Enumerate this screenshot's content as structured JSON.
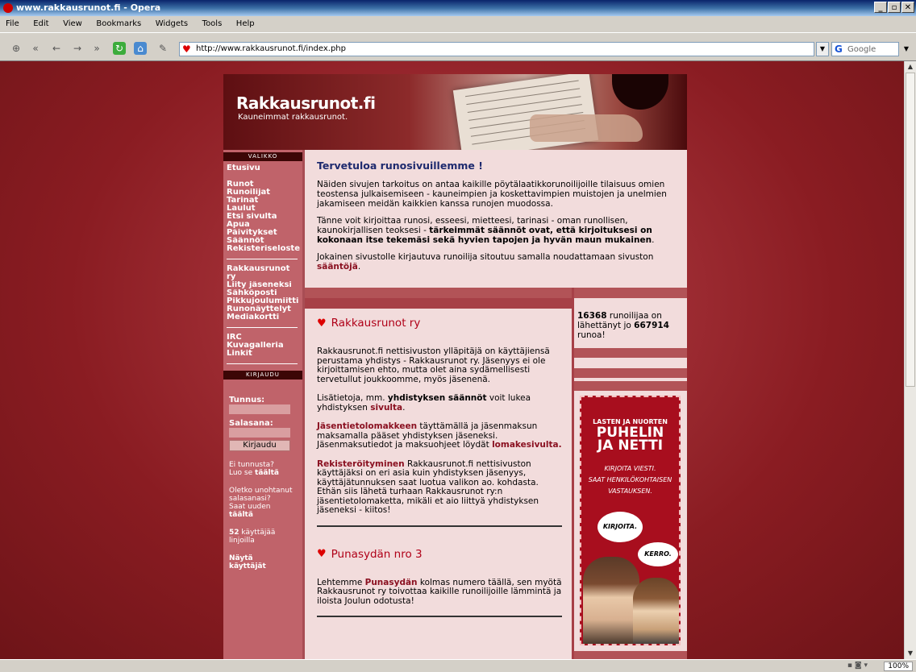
{
  "window": {
    "title": "www.rakkausrunot.fi - Opera"
  },
  "menu": [
    "File",
    "Edit",
    "View",
    "Bookmarks",
    "Widgets",
    "Tools",
    "Help"
  ],
  "address": {
    "url": "http://www.rakkausrunot.fi/index.php"
  },
  "search": {
    "placeholder": "Google"
  },
  "status": {
    "zoom": "100%"
  },
  "site": {
    "title": "Rakkausrunot.fi",
    "subtitle": "Kauneimmat rakkausrunot."
  },
  "nav": {
    "menu_heading": "VALIKKO",
    "group1": [
      "Etusivu"
    ],
    "group2": [
      "Runot",
      "Runoilijat",
      "Tarinat",
      "Laulut",
      "Etsi sivulta",
      "Apua",
      "Päivitykset",
      "Säännöt",
      "Rekisteriseloste"
    ],
    "group3": [
      "Rakkausrunot ry",
      "Liity jäseneksi",
      "Sähköposti",
      "Pikkujoulumiitti",
      "Runonäyttelyt",
      "Mediakortti"
    ],
    "group4": [
      "IRC",
      "Kuvagalleria",
      "Linkit"
    ]
  },
  "login": {
    "heading": "KIRJAUDU",
    "username_label": "Tunnus:",
    "password_label": "Salasana:",
    "button": "Kirjaudu",
    "no_account": "Ei tunnusta?",
    "create_prefix": "Luo se",
    "create_link": "täältä",
    "forgot1": "Oletko unohtanut",
    "forgot2": "salasanasi?",
    "forgot3": "Saat uuden",
    "forgot_link": "täältä",
    "online_count": "52",
    "online_text1": "käyttäjää",
    "online_text2": "linjoilla",
    "show_users": "Näytä käyttäjät"
  },
  "welcome": {
    "heading": "Tervetuloa runosivuillemme !",
    "p1": "Näiden sivujen tarkoitus on antaa kaikille pöytälaatikkorunoilijoille tilaisuus omien teostensa julkaisemiseen - kauneimpien ja koskettavimpien muistojen ja unelmien jakamiseen meidän kaikkien kanssa runojen muodossa.",
    "p2_plain": "Tänne voit kirjoittaa runosi, esseesi, mietteesi, tarinasi - oman runollisen, kaunokirjallisen teoksesi - ",
    "p2_bold": "tärkeimmät säännöt ovat, että kirjoituksesi on kokonaan itse tekemäsi sekä hyvien tapojen ja hyvän maun mukainen",
    "p2_end": ".",
    "p3_plain": "Jokainen sivustolle kirjautuva runoilija sitoutuu samalla noudattamaan sivuston",
    "p3_link": "sääntöjä",
    "p3_end": "."
  },
  "news": [
    {
      "title": "Rakkausrunot ry",
      "p1": "Rakkausrunot.fi nettisivuston ylläpitäjä on käyttäjiensä perustama yhdistys - Rakkausrunot ry. Jäsenyys ei ole kirjoittamisen ehto, mutta olet aina sydämellisesti tervetullut joukkoomme, myös jäsenenä.",
      "p2_a": "Lisätietoja, mm.",
      "p2_bold": "yhdistyksen säännöt",
      "p2_b": "voit lukea yhdistyksen",
      "p2_link": "sivulta",
      "p2_end": ".",
      "p3_link": "Jäsentietolomakkeen",
      "p3_a": "täyttämällä ja jäsenmaksun maksamalla pääset yhdistyksen jäseneksi. Jäsenmaksutiedot ja maksuohjeet löydät",
      "p3_link2": "lomakesivulta.",
      "p4_link": "Rekisteröityminen",
      "p4_a": "Rakkausrunot.fi nettisivuston käyttäjäksi on eri asia kuin yhdistyksen jäsenyys, käyttäjätunnuksen saat luotua valikon ao. kohdasta. Ethän siis lähetä turhaan Rakkausrunot ry:n jäsentietolomaketta, mikäli et aio liittyä yhdistyksen jäseneksi - kiitos!"
    },
    {
      "title": "Punasydän nro 3",
      "p1_a": "Lehtemme",
      "p1_link": "Punasydän",
      "p1_b": "kolmas numero täällä, sen myötä Rakkausrunot ry toivottaa kaikille runoilijoille lämmintä ja iloista Joulun odotusta!"
    }
  ],
  "stats": {
    "poets": "16368",
    "poets_text": "runoilijaa on lähettänyt jo",
    "poems": "667914",
    "poems_text": "runoa!"
  },
  "ad": {
    "line1": "LASTEN JA NUORTEN",
    "line2": "PUHELIN",
    "line3": "JA NETTI",
    "line4": "KIRJOITA VIESTI.",
    "line5": "SAAT HENKILÖKOHTAISEN",
    "line6": "VASTAUKSEN.",
    "bubble1": "KIRJOITA.",
    "bubble2": "KERRO."
  }
}
